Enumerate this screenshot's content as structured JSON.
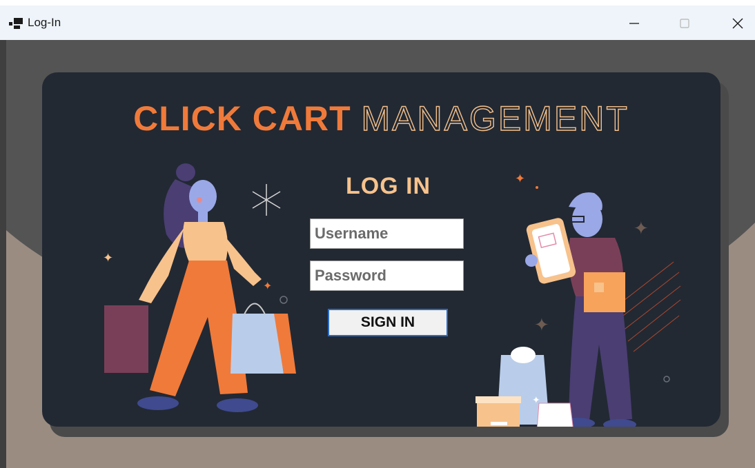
{
  "window": {
    "title": "Log-In",
    "icon": "app-window-icon",
    "controls": {
      "minimize": "minimize-icon",
      "maximize": "maximize-icon",
      "close": "close-icon"
    }
  },
  "card": {
    "brand_part1": "CLICK CART",
    "brand_part2": "MANAGEMENT",
    "heading": "LOG IN",
    "username_placeholder": "Username",
    "password_placeholder": "Password",
    "signin_label": "SIGN IN"
  },
  "colors": {
    "accent_orange": "#f07a3a",
    "accent_peach": "#f7c28c",
    "card_background": "#222933",
    "button_border": "#2a6cc7"
  }
}
